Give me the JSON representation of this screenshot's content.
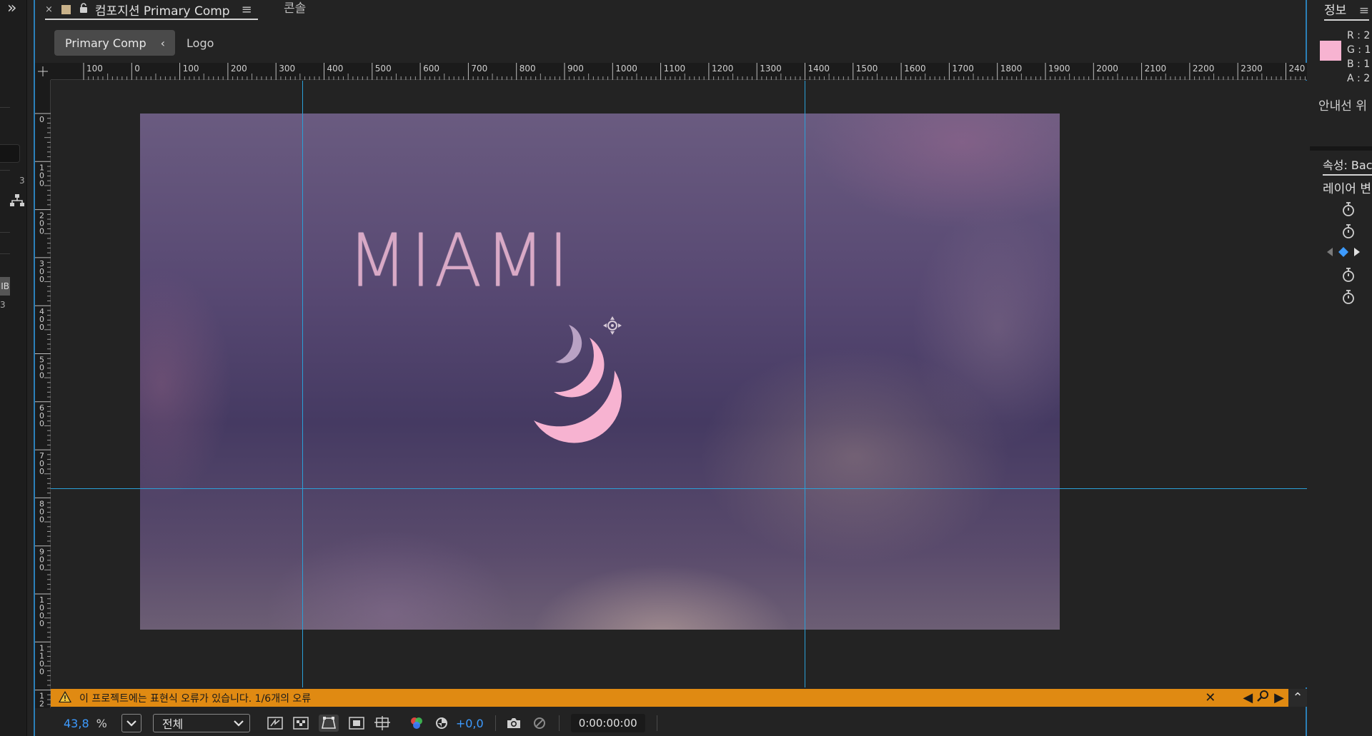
{
  "panel": {
    "tab_title": "컴포지션 Primary Comp",
    "console_tab": "콘솔"
  },
  "breadcrumb": {
    "active": "Primary Comp",
    "next": "Logo"
  },
  "rulers": {
    "top_labels": [
      "100",
      "0",
      "100",
      "200",
      "300",
      "400",
      "500",
      "600",
      "700",
      "800",
      "900",
      "1000",
      "1100",
      "1200",
      "1300",
      "1400",
      "1500",
      "1600",
      "1700",
      "1800",
      "1900",
      "2000",
      "2100",
      "2200",
      "2300",
      "240"
    ],
    "left_labels": [
      "0",
      "100",
      "200",
      "300",
      "400",
      "500",
      "600",
      "700",
      "800",
      "900",
      "1000",
      "1100",
      "12"
    ]
  },
  "composition": {
    "title_text": "MIAMI",
    "logo_color": "#f7b3d1",
    "logo_inner_color": "#b9a2c4",
    "guide_color": "#2aa0d8"
  },
  "error_bar": {
    "message": "이 프로젝트에는 표현식 오류가 있습니다. 1/6개의 오류",
    "color": "#e08a12"
  },
  "toolbar": {
    "zoom_value": "43,8",
    "zoom_unit": "%",
    "resolution": "전체",
    "exposure": "+0,0",
    "timecode": "0:00:00:00"
  },
  "info_panel": {
    "tab_title": "정보",
    "r": "R : 2",
    "g": "G : 1",
    "b": "B : 1",
    "a": "A : 2",
    "guide_position": "안내선 위",
    "swatch_color": "#f7b3d1"
  },
  "properties": {
    "title": "속성: Bac",
    "section": "레이어 변"
  },
  "left_strip": {
    "glyph_3": "3",
    "ib": "IB",
    "b3": "3"
  }
}
